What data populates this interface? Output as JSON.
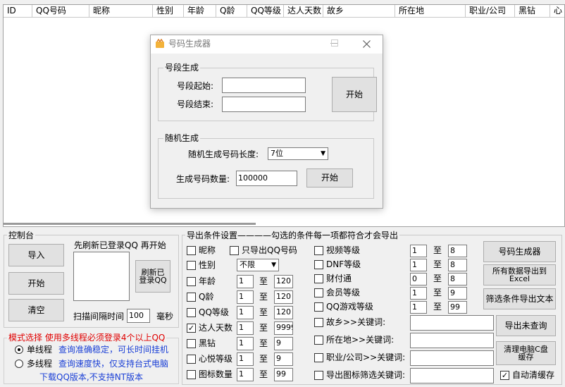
{
  "table": {
    "columns": [
      "ID",
      "QQ号码",
      "昵称",
      "性别",
      "年龄",
      "Q龄",
      "QQ等级",
      "达人天数",
      "故乡",
      "所在地",
      "职业/公司",
      "黑钻",
      "心"
    ]
  },
  "console": {
    "title": "控制台",
    "import_label": "导入",
    "start_label": "开始",
    "clear_label": "清空",
    "refresh_hint": "先刷新已登录QQ  再开始",
    "refresh_button": "刷新已登录QQ",
    "scan_label": "扫描间隔时间",
    "scan_value": "100",
    "scan_unit": "毫秒"
  },
  "mode": {
    "title": "模式选择  使用多线程必须登录4个以上QQ",
    "single_label": "单线程",
    "single_desc": "查询准确稳定，可长时间挂机",
    "multi_label": "多线程",
    "multi_desc": "查询速度快，仅支持台式电脑",
    "download_note": "下载QQ版本,不支持NT版本"
  },
  "export": {
    "title": "导出条件设置————勾选的条件每一项都符合才会导出",
    "to_label": "至",
    "nickname": "昵称",
    "only_qq": "只导出QQ号码",
    "gender": "性别",
    "gender_value": "不限",
    "left_rows": [
      {
        "label": "年龄",
        "from": "1",
        "to": "120",
        "checked": false
      },
      {
        "label": "Q龄",
        "from": "1",
        "to": "120",
        "checked": false
      },
      {
        "label": "QQ等级",
        "from": "1",
        "to": "120",
        "checked": false
      },
      {
        "label": "达人天数",
        "from": "1",
        "to": "9999",
        "checked": true
      },
      {
        "label": "黑钻",
        "from": "1",
        "to": "9",
        "checked": false
      },
      {
        "label": "心悦等级",
        "from": "1",
        "to": "9",
        "checked": false
      },
      {
        "label": "图标数量",
        "from": "1",
        "to": "99",
        "checked": false
      }
    ],
    "mid_rows": [
      {
        "label": "视频等级",
        "from": "1",
        "to": "8"
      },
      {
        "label": "DNF等级",
        "from": "1",
        "to": "8"
      },
      {
        "label": "财付通",
        "from": "0",
        "to": "8"
      },
      {
        "label": "会员等级",
        "from": "1",
        "to": "9"
      },
      {
        "label": "QQ游戏等级",
        "from": "1",
        "to": "99"
      }
    ],
    "keyword_rows": [
      {
        "label": "故乡>>关键词:"
      },
      {
        "label": "所在地>>关键词:"
      },
      {
        "label": "职业/公司>>关键词:"
      },
      {
        "label": "导出图标筛选关键词:"
      }
    ]
  },
  "right_buttons": {
    "generator": "号码生成器",
    "export_excel": "所有数据导出到Excel",
    "filter_export": "筛选条件导出文本",
    "export_unqueried": "导出未查询",
    "clean_cache": "清理电脑C盘缓存",
    "auto_clean": "自动清缓存"
  },
  "dialog": {
    "title": "号码生成器",
    "segment_group": "号段生成",
    "start_label": "号段起始:",
    "end_label": "号段结束:",
    "start_value": "",
    "end_value": "",
    "start_button": "开始",
    "random_group": "随机生成",
    "length_label": "随机生成号码长度:",
    "length_value": "7位",
    "count_label": "生成号码数量:",
    "count_value": "100000",
    "random_button": "开始"
  }
}
